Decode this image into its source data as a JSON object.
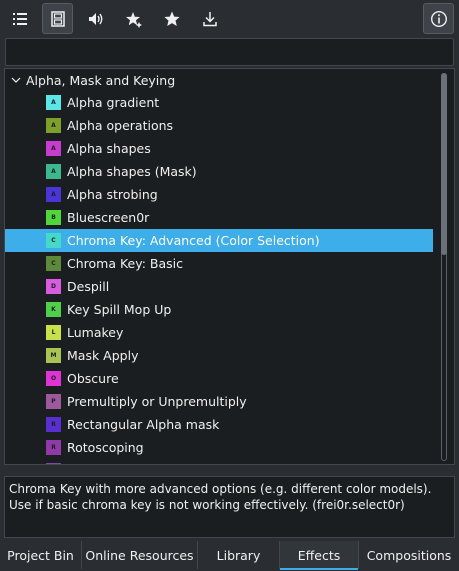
{
  "toolbar": {
    "buttons": [
      {
        "name": "list-view",
        "icon": "list-icon",
        "active": false
      },
      {
        "name": "video",
        "icon": "film-icon",
        "active": true
      },
      {
        "name": "audio",
        "icon": "speaker-icon",
        "active": false
      },
      {
        "name": "custom",
        "icon": "star-sparkle-icon",
        "active": false
      },
      {
        "name": "favorites",
        "icon": "star-icon",
        "active": false
      },
      {
        "name": "download",
        "icon": "download-icon",
        "active": false
      },
      {
        "name": "info",
        "icon": "info-icon",
        "active": false
      }
    ]
  },
  "search": {
    "value": "",
    "placeholder": ""
  },
  "tree": {
    "group": "Alpha, Mask and Keying",
    "items": [
      {
        "label": "Alpha gradient",
        "letter": "A",
        "color": "#5ce6e6"
      },
      {
        "label": "Alpha operations",
        "letter": "A",
        "color": "#7da02b"
      },
      {
        "label": "Alpha shapes",
        "letter": "A",
        "color": "#c53ccf"
      },
      {
        "label": "Alpha shapes (Mask)",
        "letter": "A",
        "color": "#3cb88f"
      },
      {
        "label": "Alpha strobing",
        "letter": "A",
        "color": "#4a35d6"
      },
      {
        "label": "Bluescreen0r",
        "letter": "B",
        "color": "#4ed63a"
      },
      {
        "label": "Chroma Key: Advanced (Color Selection)",
        "letter": "C",
        "color": "#45d9c8",
        "selected": true
      },
      {
        "label": "Chroma Key: Basic",
        "letter": "C",
        "color": "#5c8a3a"
      },
      {
        "label": "Despill",
        "letter": "D",
        "color": "#d95be0"
      },
      {
        "label": "Key Spill Mop Up",
        "letter": "K",
        "color": "#4fcf4a"
      },
      {
        "label": "Lumakey",
        "letter": "L",
        "color": "#c8e04a"
      },
      {
        "label": "Mask Apply",
        "letter": "M",
        "color": "#a9c452"
      },
      {
        "label": "Obscure",
        "letter": "O",
        "color": "#e033d6"
      },
      {
        "label": "Premultiply or Unpremultiply",
        "letter": "P",
        "color": "#9c5a9c"
      },
      {
        "label": "Rectangular Alpha mask",
        "letter": "R",
        "color": "#5a2fcf"
      },
      {
        "label": "Rotoscoping",
        "letter": "R",
        "color": "#8f3aa8"
      },
      {
        "label": "",
        "letter": "S",
        "color": "#7a4aa8"
      }
    ]
  },
  "description": "Chroma Key with more advanced options (e.g. different color models). Use if basic chroma key is not working effectively. (frei0r.select0r)",
  "tabs": [
    {
      "label": "Project Bin"
    },
    {
      "label": "Online Resources"
    },
    {
      "label": "Library"
    },
    {
      "label": "Effects",
      "active": true
    },
    {
      "label": "Compositions"
    }
  ],
  "colors": {
    "accent": "#3daee9",
    "background": "#2a2e32",
    "panel": "#1b1e20"
  }
}
